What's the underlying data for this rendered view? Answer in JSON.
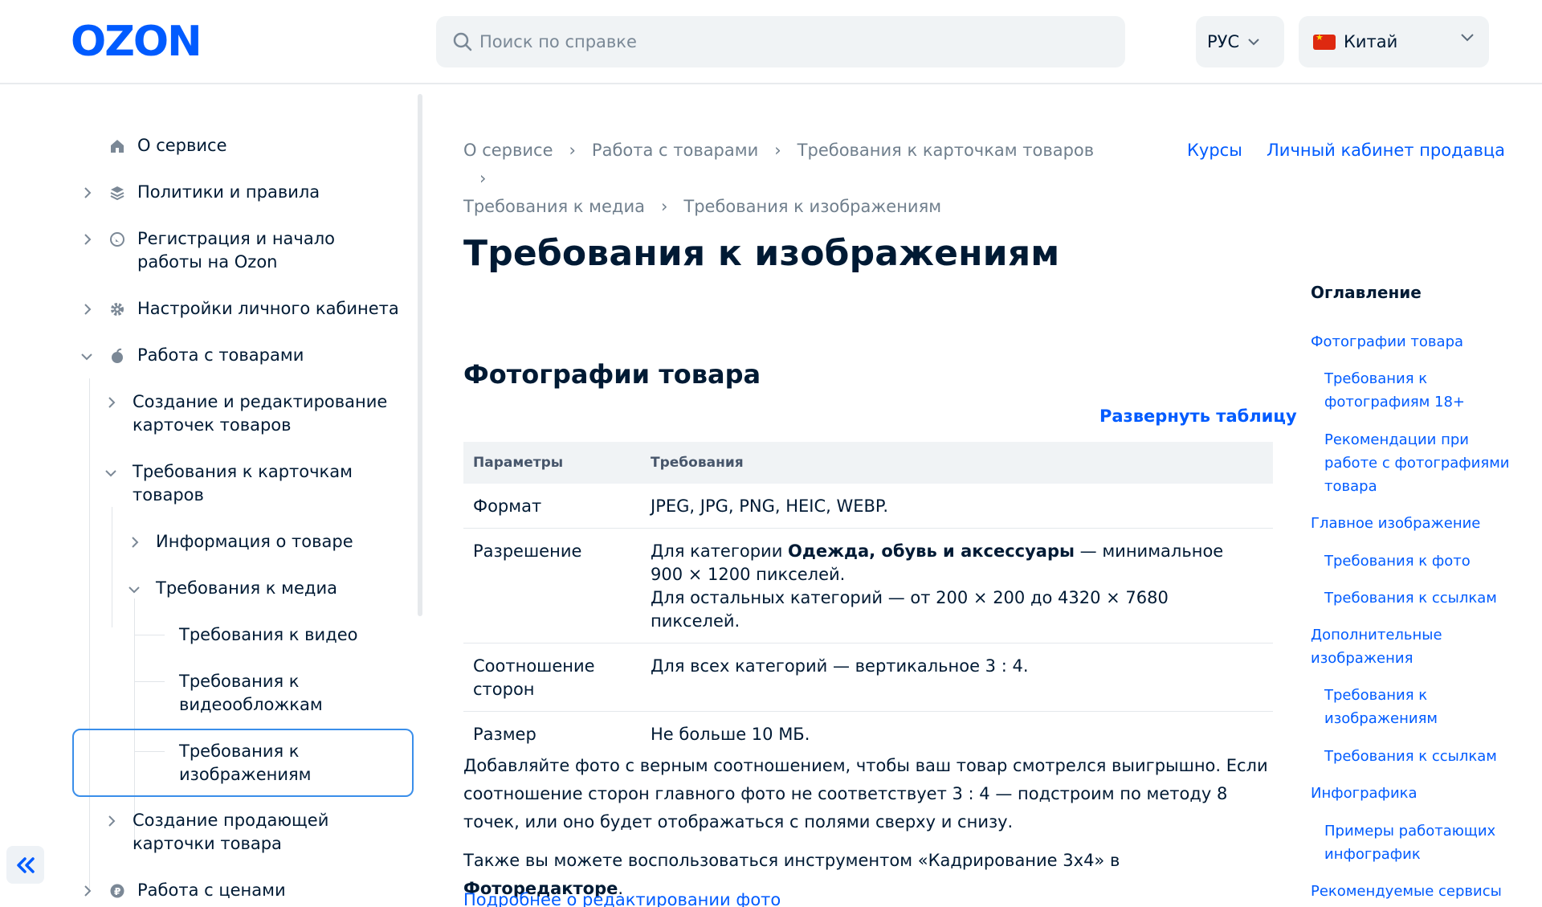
{
  "header": {
    "logo_text": "OZON",
    "search_placeholder": "Поиск по справке",
    "language": "РУС",
    "country": "Китай"
  },
  "sidebar": {
    "items": [
      {
        "label": "О сервисе"
      },
      {
        "label": "Политики и правила"
      },
      {
        "label": "Регистрация и начало работы на Ozon"
      },
      {
        "label": "Настройки личного кабинета"
      },
      {
        "label": "Работа с товарами"
      },
      {
        "label": "Создание и редактирование карточек товаров"
      },
      {
        "label": "Требования к карточкам товаров"
      },
      {
        "label": "Информация о товаре"
      },
      {
        "label": "Требования к медиа"
      },
      {
        "label": "Требования к видео"
      },
      {
        "label": "Требования к видеообложкам"
      },
      {
        "label": "Требования к изображениям"
      },
      {
        "label": "Создание продающей карточки товара"
      },
      {
        "label": "Работа с ценами"
      }
    ]
  },
  "breadcrumb": [
    "О сервисе",
    "Работа с товарами",
    "Требования к карточкам товаров",
    "Требования к медиа",
    "Требования к изображениям"
  ],
  "top_links": {
    "courses": "Курсы",
    "seller_cabinet": "Личный кабинет продавца"
  },
  "main": {
    "title": "Требования к изображениям",
    "section_title": "Фотографии товара",
    "expand_table": "Развернуть таблицу",
    "table": {
      "headers": [
        "Параметры",
        "Требования"
      ],
      "rows": [
        {
          "param": "Формат",
          "req": "JPEG, JPG, PNG, HEIC, WEBP."
        },
        {
          "param": "Разрешение",
          "req_pre": "Для категории ",
          "req_bold": "Одежда, обувь и аксессуары",
          "req_post": " — минимальное 900 × 1200 пикселей.",
          "req_line2": "Для остальных категорий — от 200 × 200 до 4320 × 7680 пикселей."
        },
        {
          "param": "Соотношение сторон",
          "req": "Для всех категорий — вертикальное 3 : 4."
        },
        {
          "param": "Размер",
          "req": "Не больше 10 МБ."
        }
      ]
    },
    "para1": "Добавляйте фото с верным соотношением, чтобы ваш товар смотрелся выигрышно. Если соотношение сторон главного фото не соответствует 3 : 4 — подстроим по методу 8 точек, или оно будет отображаться с полями сверху и снизу.",
    "para2_pre": "Также вы можете воспользоваться инструментом «Кадрирование 3х4» в ",
    "para2_bold": "Фоторедакторе",
    "para2_post": ".",
    "more_link": "Подробнее о редактировании фото"
  },
  "toc": {
    "title": "Оглавление",
    "items": [
      "Фотографии товара",
      "Требования к фотографиям 18+",
      "Рекомендации при работе с фотографиями товара",
      "Главное изображение",
      "Требования к фото",
      "Требования к ссылкам",
      "Дополнительные изображения",
      "Требования к изображениям",
      "Требования к ссылкам",
      "Инфографика",
      "Примеры работающих инфографик",
      "Рекомендуемые сервисы"
    ]
  },
  "colors": {
    "brand_blue": "#005bff",
    "text_dark": "#001a34",
    "text_muted": "#707f8d",
    "selection_border": "#3a8eea"
  }
}
